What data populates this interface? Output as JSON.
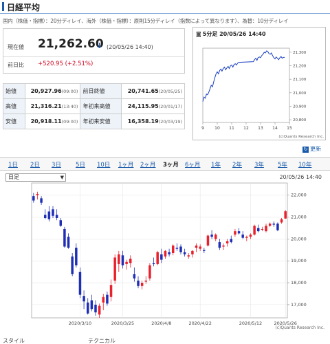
{
  "header": {
    "title": "日経平均"
  },
  "notice": "国内（株価・指標）：20分ディレイ、海外（株価・指標）：原則15分ディレイ（指数によって異なります）、為替：10分ディレイ",
  "price": {
    "label_current": "現在値",
    "value": "21,262.60",
    "time": "(20/05/26 14:40)",
    "label_change": "前日比",
    "change": "+520.95 (+2.51%)"
  },
  "stats": {
    "open_label": "始値",
    "open_value": "20,927.96",
    "open_time": "(09:00)",
    "prev_close_label": "前日終値",
    "prev_close_value": "20,741.65",
    "prev_close_time": "(20/05/25)",
    "high_label": "高値",
    "high_value": "21,316.21",
    "high_time": "(13:40)",
    "ytd_high_label": "年初来高値",
    "ytd_high_value": "24,115.95",
    "ytd_high_time": "(20/01/17)",
    "low_label": "安値",
    "low_value": "20,918.11",
    "low_time": "(09:00)",
    "ytd_low_label": "年初来安値",
    "ytd_low_value": "16,358.19",
    "ytd_low_time": "(20/03/19)"
  },
  "mini_chart": {
    "title": "5分足 20/05/26 14:40",
    "credit": "(c)Quants Research Inc."
  },
  "refresh_label": "更新",
  "tabs": [
    "1日",
    "2日",
    "3日",
    "5日",
    "10日",
    "1ヶ月",
    "2ヶ月",
    "3ヶ月",
    "6ヶ月",
    "1年",
    "2年",
    "3年",
    "5年",
    "10年"
  ],
  "active_tab": "3ヶ月",
  "candle": {
    "select_value": "日足",
    "time": "20/05/26 14:40",
    "credit": "(c)Quants Research Inc."
  },
  "bottom": {
    "left": "スタイル",
    "right": "テクニカル"
  },
  "colors": {
    "up": "#e8212c",
    "down": "#1f2fb5",
    "line": "#1a3fbf",
    "accent": "#1a5aab"
  },
  "chart_data": [
    {
      "type": "line",
      "title": "5分足 20/05/26 14:40",
      "x": [
        9.0,
        9.08,
        9.17,
        9.25,
        9.33,
        9.42,
        9.5,
        9.58,
        9.67,
        9.75,
        9.83,
        9.92,
        10.0,
        10.08,
        10.17,
        10.25,
        10.33,
        10.42,
        10.5,
        10.58,
        10.67,
        10.75,
        10.83,
        10.92,
        11.0,
        11.08,
        11.17,
        11.25,
        11.33,
        11.42,
        11.5,
        12.5,
        12.58,
        12.67,
        12.75,
        12.83,
        12.92,
        13.0,
        13.08,
        13.17,
        13.25,
        13.33,
        13.42,
        13.5,
        13.58,
        13.67,
        13.75,
        13.83,
        13.92,
        14.0,
        14.08,
        14.17,
        14.25,
        14.33,
        14.42,
        14.5,
        14.58,
        14.67
      ],
      "y": [
        20935,
        20968,
        20960,
        20990,
        20985,
        21005,
        21030,
        21055,
        21045,
        21080,
        21110,
        21140,
        21155,
        21140,
        21165,
        21175,
        21160,
        21180,
        21190,
        21170,
        21185,
        21195,
        21180,
        21200,
        21205,
        21190,
        21210,
        21215,
        21205,
        21220,
        21225,
        21230,
        21245,
        21255,
        21240,
        21260,
        21265,
        21260,
        21275,
        21285,
        21300,
        21295,
        21310,
        21305,
        21290,
        21285,
        21295,
        21275,
        21260,
        21250,
        21265,
        21255,
        21245,
        21258,
        21268,
        21255,
        21262,
        21262
      ],
      "xticks": [
        9,
        10,
        11,
        12,
        13,
        14,
        15
      ],
      "yticks": [
        20800,
        20900,
        21000,
        21100,
        21200,
        21300
      ],
      "xlim": [
        9,
        15
      ],
      "ylim": [
        20780,
        21330
      ]
    },
    {
      "type": "candlestick",
      "x_ticks": [
        "2020/3/10",
        "2020/3/25",
        "2020/4/8",
        "2020/4/22",
        "2020/5/12",
        "2020/5/26"
      ],
      "x_tick_index": [
        12,
        23,
        33,
        43,
        56,
        65
      ],
      "yticks": [
        17000,
        18000,
        19000,
        20000,
        21000,
        22000
      ],
      "ylim": [
        16400,
        22550
      ],
      "ohlc": [
        [
          21950,
          22100,
          21650,
          21750
        ],
        [
          22000,
          22150,
          21800,
          22050
        ],
        [
          21850,
          21950,
          21550,
          21650
        ],
        [
          21100,
          21350,
          20900,
          20950
        ],
        [
          21250,
          21500,
          20800,
          20900
        ],
        [
          21350,
          21500,
          20950,
          21050
        ],
        [
          21100,
          21350,
          20850,
          20950
        ],
        [
          20850,
          20950,
          20550,
          20600
        ],
        [
          20450,
          20550,
          19600,
          19650
        ],
        [
          20100,
          20250,
          19550,
          19600
        ],
        [
          19200,
          19350,
          18300,
          18400
        ],
        [
          19600,
          19800,
          18700,
          18800
        ],
        [
          18500,
          18700,
          17300,
          17450
        ],
        [
          17400,
          17650,
          16800,
          17150
        ],
        [
          17100,
          17300,
          16550,
          16600
        ],
        [
          17200,
          17450,
          16700,
          16800
        ],
        [
          17000,
          17200,
          16500,
          16650
        ],
        [
          16550,
          17050,
          16400,
          16950
        ],
        [
          17100,
          17500,
          16750,
          17350
        ],
        [
          17450,
          17600,
          16950,
          17050
        ],
        [
          17350,
          18150,
          17150,
          17900
        ],
        [
          18100,
          19300,
          17950,
          19150
        ],
        [
          18850,
          19450,
          18500,
          19300
        ],
        [
          19250,
          19450,
          18650,
          18800
        ],
        [
          18850,
          19050,
          18600,
          18950
        ],
        [
          18900,
          19250,
          18700,
          19100
        ],
        [
          18400,
          18700,
          18050,
          18200
        ],
        [
          18100,
          18300,
          17750,
          17850
        ],
        [
          17850,
          18100,
          17700,
          18000
        ],
        [
          18050,
          18300,
          17950,
          18100
        ],
        [
          18200,
          18900,
          18100,
          18800
        ],
        [
          18900,
          19150,
          18750,
          18850
        ],
        [
          18850,
          19450,
          18800,
          19400
        ],
        [
          19300,
          19550,
          18900,
          19050
        ],
        [
          19200,
          19500,
          19100,
          19450
        ],
        [
          19400,
          19550,
          19200,
          19300
        ],
        [
          19350,
          19750,
          19250,
          19700
        ],
        [
          19600,
          19800,
          19450,
          19550
        ],
        [
          19650,
          19750,
          19300,
          19400
        ],
        [
          19400,
          19550,
          19200,
          19300
        ],
        [
          19200,
          19350,
          19100,
          19250
        ],
        [
          19300,
          19500,
          19150,
          19450
        ],
        [
          19600,
          19800,
          19400,
          19700
        ],
        [
          19550,
          19750,
          19450,
          19650
        ],
        [
          19500,
          19600,
          19350,
          19450
        ],
        [
          19700,
          20200,
          19650,
          20150
        ],
        [
          20200,
          20400,
          20000,
          20100
        ],
        [
          20000,
          20250,
          19900,
          20200
        ],
        [
          19850,
          20000,
          19500,
          19600
        ],
        [
          19650,
          19800,
          19500,
          19700
        ],
        [
          19800,
          20000,
          19650,
          19900
        ],
        [
          20000,
          20150,
          19800,
          19850
        ],
        [
          20200,
          20450,
          20100,
          20350
        ],
        [
          20350,
          20500,
          20200,
          20250
        ],
        [
          20200,
          20350,
          20000,
          20050
        ],
        [
          20050,
          20150,
          19900,
          20100
        ],
        [
          20100,
          20250,
          20000,
          20200
        ],
        [
          20200,
          20650,
          20150,
          20600
        ],
        [
          20500,
          20650,
          20300,
          20350
        ],
        [
          20450,
          20550,
          20350,
          20450
        ],
        [
          20350,
          20700,
          20300,
          20600
        ],
        [
          20600,
          20750,
          20550,
          20700
        ],
        [
          20700,
          20800,
          20550,
          20650
        ],
        [
          20700,
          20750,
          20350,
          20400
        ],
        [
          20750,
          20950,
          20700,
          20900
        ],
        [
          20930,
          21320,
          20920,
          21260
        ]
      ]
    }
  ]
}
